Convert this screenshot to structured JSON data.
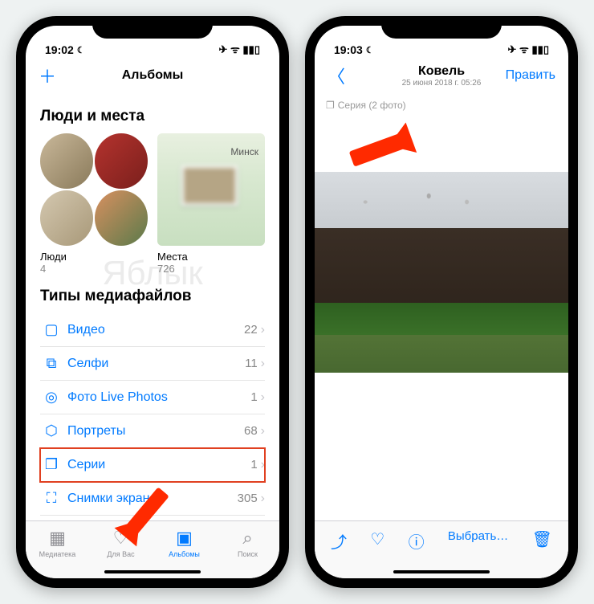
{
  "left": {
    "status": {
      "time": "19:02",
      "icons": "✈ ᯤ ▮▮▯"
    },
    "nav": {
      "add": "＋",
      "title": "Альбомы"
    },
    "section1": "Люди и места",
    "map_city": "Минск",
    "albums": {
      "people": {
        "name": "Люди",
        "count": "4"
      },
      "places": {
        "name": "Места",
        "count": "726"
      }
    },
    "section2": "Типы медиафайлов",
    "media": [
      {
        "icon": "▢",
        "label": "Видео",
        "count": "22"
      },
      {
        "icon": "⧉",
        "label": "Селфи",
        "count": "11"
      },
      {
        "icon": "◎",
        "label": "Фото Live Photos",
        "count": "1"
      },
      {
        "icon": "⬡",
        "label": "Портреты",
        "count": "68"
      },
      {
        "icon": "❐",
        "label": "Серии",
        "count": "1"
      },
      {
        "icon": "⛶",
        "label": "Снимки экрана",
        "count": "305"
      }
    ],
    "tabs": [
      {
        "icon": "▦",
        "label": "Медиатека"
      },
      {
        "icon": "♡",
        "label": "Для Вас"
      },
      {
        "icon": "▣",
        "label": "Альбомы"
      },
      {
        "icon": "⌕",
        "label": "Поиск"
      }
    ]
  },
  "right": {
    "status": {
      "time": "19:03",
      "icons": "✈ ᯤ ▮▮▯"
    },
    "nav": {
      "back": "〈",
      "title": "Ковель",
      "subtitle": "25 июня 2018 г.  05:26",
      "edit": "Править"
    },
    "burst": "Серия (2 фото)",
    "toolbar": {
      "share": "⤴",
      "heart": "♡",
      "info": "ⓘ",
      "select": "Выбрать…",
      "trash": "🗑"
    }
  },
  "watermark": "Яблык"
}
